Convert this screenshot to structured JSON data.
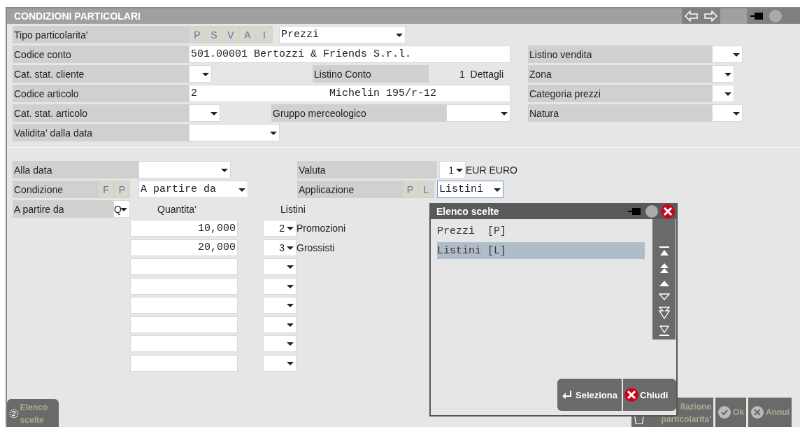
{
  "window": {
    "title": "CONDIZIONI PARTICOLARI"
  },
  "tipo": {
    "label": "Tipo particolarita'",
    "letters": [
      "P",
      "S",
      "V",
      "A",
      "I"
    ],
    "value": "Prezzi"
  },
  "codice_conto": {
    "label": "Codice conto",
    "value": "501.00001 Bertozzi & Friends S.r.l."
  },
  "cat_stat_cliente": {
    "label": "Cat. stat. cliente"
  },
  "listino_conto": {
    "label": "Listino Conto",
    "code": "1",
    "name": "Dettagli"
  },
  "codice_articolo": {
    "label": "Codice articolo",
    "code": "2",
    "description": "Michelin 195/r-12"
  },
  "cat_stat_articolo": {
    "label": "Cat. stat. articolo"
  },
  "gruppo_merceologico": {
    "label": "Gruppo merceologico"
  },
  "validita": {
    "label": "Validita' dalla data"
  },
  "right_fields": [
    {
      "label": "Listino vendita"
    },
    {
      "label": "Zona"
    },
    {
      "label": "Categoria prezzi"
    },
    {
      "label": "Natura"
    }
  ],
  "alla_data": {
    "label": "Alla data"
  },
  "valuta": {
    "label": "Valuta",
    "code": "1",
    "name": "EUR EURO"
  },
  "condizione": {
    "label": "Condizione",
    "letters": [
      "F",
      "P"
    ],
    "value": "A partire da"
  },
  "applicazione": {
    "label": "Applicazione",
    "letters": [
      "P",
      "L"
    ],
    "value": "Listini"
  },
  "a_partire_da": {
    "label": "A partire da",
    "value": "Q",
    "quantity_header": "Quantita'",
    "listini_header": "Listini"
  },
  "rows": [
    {
      "quantity": "10,000",
      "code": "2",
      "name": "Promozioni"
    },
    {
      "quantity": "20,000",
      "code": "3",
      "name": "Grossisti"
    },
    {},
    {},
    {},
    {},
    {},
    {}
  ],
  "popup": {
    "title": "Elenco scelte",
    "items": [
      {
        "label": "Prezzi  [P]",
        "selected": false
      },
      {
        "label": "Listini [L]",
        "selected": true
      }
    ],
    "buttons": [
      "Seleziona",
      "Chiudi"
    ]
  },
  "toolbar": {
    "left": "Elenco scelte",
    "right": [
      "llazione particolarita'",
      "Ok",
      "Annul"
    ]
  }
}
